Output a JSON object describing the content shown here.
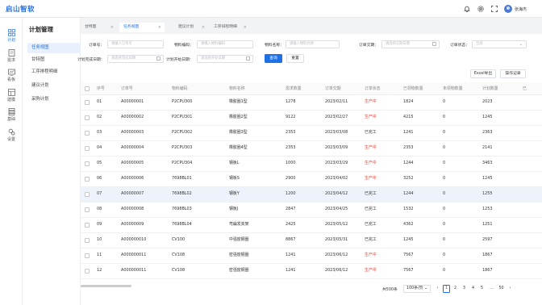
{
  "app": {
    "logo": "启山智软",
    "user": "张海杰"
  },
  "rail": [
    {
      "label": "计划",
      "icon": "grid-icon",
      "active": true
    },
    {
      "label": "需求",
      "icon": "document-icon",
      "active": false
    },
    {
      "label": "看板",
      "icon": "board-icon",
      "active": false
    },
    {
      "label": "建模",
      "icon": "model-icon",
      "active": false
    },
    {
      "label": "基础",
      "icon": "database-icon",
      "active": false
    },
    {
      "label": "设置",
      "icon": "settings-icon",
      "active": false
    }
  ],
  "submenu": {
    "title": "计划管理",
    "items": [
      "任务视图",
      "甘特图",
      "工序排程明细",
      "建议计划",
      "采购计划"
    ]
  },
  "tabs": [
    "甘特图",
    "任务视图",
    "建议计划",
    "工序排程明细"
  ],
  "filters": {
    "order_no": {
      "label": "订单号：",
      "placeholder": "请输入订单号"
    },
    "material_code": {
      "label": "物料编码：",
      "placeholder": "请输入物料编码"
    },
    "material_name": {
      "label": "物料名称：",
      "placeholder": "请输入物料名称"
    },
    "order_delivery": {
      "label": "订单交期：",
      "placeholder": "请选择交期日期"
    },
    "order_status": {
      "label": "订单状态：",
      "placeholder": "全部"
    },
    "plan_finish": {
      "label": "计划完成日期：",
      "placeholder": "请选择完成日期"
    },
    "plan_start": {
      "label": "计划开始日期：",
      "placeholder": "请选择开始日期"
    },
    "query": "查询",
    "reset": "重置",
    "export": "Excel导出",
    "log": "操作记录"
  },
  "table": {
    "headers": [
      "序号",
      "订单号",
      "物料编码",
      "物料名称",
      "需求数量",
      "订单交期",
      "订单状态",
      "已领物数量",
      "未领物数量",
      "计划数量",
      "已"
    ],
    "rows": [
      {
        "no": "01",
        "order": "A00000001",
        "code": "P2CPU300",
        "name": "橡胶圈1型",
        "qty": "1278",
        "date": "2023/02/11",
        "status": "生产中",
        "received": "1824",
        "pending": "0",
        "plan": "2023"
      },
      {
        "no": "02",
        "order": "A00000002",
        "code": "P2CPU301",
        "name": "橡胶圈2型",
        "qty": "9122",
        "date": "2023/02/27",
        "status": "生产中",
        "received": "4215",
        "pending": "0",
        "plan": "1245"
      },
      {
        "no": "03",
        "order": "A00000003",
        "code": "P2CPU302",
        "name": "橡胶圈3型",
        "qty": "2353",
        "date": "2023/03/08",
        "status": "已完工",
        "received": "1241",
        "pending": "0",
        "plan": "2363"
      },
      {
        "no": "04",
        "order": "A00000004",
        "code": "P2CPU303",
        "name": "橡胶圈4型",
        "qty": "2353",
        "date": "2023/03/09",
        "status": "生产中",
        "received": "2353",
        "pending": "0",
        "plan": "2141"
      },
      {
        "no": "05",
        "order": "A00000005",
        "code": "P2CPU304",
        "name": "钢板L",
        "qty": "1000",
        "date": "2023/03/29",
        "status": "生产中",
        "received": "1244",
        "pending": "0",
        "plan": "3463"
      },
      {
        "no": "06",
        "order": "A00000006",
        "code": "7698BL01",
        "name": "钢板S",
        "qty": "2900",
        "date": "2023/04/02",
        "status": "生产中",
        "received": "3252",
        "pending": "0",
        "plan": "1245"
      },
      {
        "no": "07",
        "order": "A00000007",
        "code": "7698BL02",
        "name": "钢板Y",
        "qty": "1200",
        "date": "2023/04/12",
        "status": "已完工",
        "received": "1244",
        "pending": "0",
        "plan": "1255"
      },
      {
        "no": "08",
        "order": "A00000008",
        "code": "7698BL03",
        "name": "钢板J",
        "qty": "2847",
        "date": "2023/04/25",
        "status": "已完工",
        "received": "1532",
        "pending": "0",
        "plan": "1253"
      },
      {
        "no": "09",
        "order": "A00000009",
        "code": "7698BL04",
        "name": "弯扁发夹架",
        "qty": "2425",
        "date": "2023/05/12",
        "status": "已完工",
        "received": "4362",
        "pending": "0",
        "plan": "1251"
      },
      {
        "no": "10",
        "order": "A000000010",
        "code": "CV100",
        "name": "中强度钢圈",
        "qty": "8867",
        "date": "2023/05/31",
        "status": "已完工",
        "received": "1245",
        "pending": "0",
        "plan": "2597"
      },
      {
        "no": "11",
        "order": "A000000011",
        "code": "CV108",
        "name": "密强度钢圈",
        "qty": "1241",
        "date": "2023/06/12",
        "status": "生产中",
        "received": "7567",
        "pending": "0",
        "plan": "1867"
      },
      {
        "no": "12",
        "order": "A000000011",
        "code": "CV108",
        "name": "密强度钢圈",
        "qty": "1241",
        "date": "2023/06/12",
        "status": "生产中",
        "received": "7567",
        "pending": "0",
        "plan": "1867"
      }
    ]
  },
  "pagination": {
    "total": "共500条",
    "page_size": "100条/页",
    "pages": [
      "1",
      "2",
      "3",
      "4",
      "5",
      "...",
      "50"
    ],
    "prev": "‹",
    "next": "›"
  },
  "colors": {
    "accent": "#1f6fe5",
    "status_active": "#e6463d"
  }
}
